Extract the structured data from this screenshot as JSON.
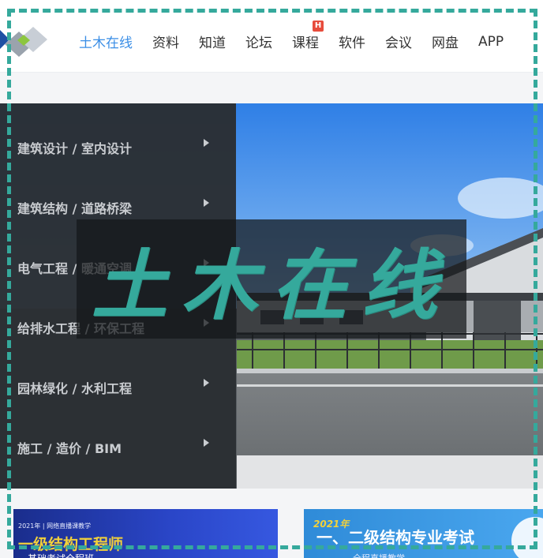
{
  "nav": {
    "items": [
      {
        "label": "土木在线",
        "active": true
      },
      {
        "label": "资料"
      },
      {
        "label": "知道"
      },
      {
        "label": "论坛"
      },
      {
        "label": "课程",
        "badge": "H"
      },
      {
        "label": "软件"
      },
      {
        "label": "会议"
      },
      {
        "label": "网盘"
      },
      {
        "label": "APP"
      }
    ]
  },
  "categories": [
    "建筑设计 / 室内设计",
    "建筑结构 / 道路桥梁",
    "电气工程 / 暖通空调",
    "给排水工程 / 环保工程",
    "园林绿化 / 水利工程",
    "施工 / 造价 / BIM"
  ],
  "watermark": "土木在线",
  "banners": {
    "left": {
      "tag": "2021年 | 网络直播课教学",
      "title": "一级结构工程师",
      "subtitle": "基础考试全程班"
    },
    "right": {
      "year": "2021年",
      "title": "一、二级结构专业考试",
      "subtitle": "全程直播教学"
    }
  },
  "colors": {
    "accent": "#3a8ee6",
    "frame": "#35a99c",
    "menu_bg": "#2a2e33",
    "badge": "#e74c3c"
  }
}
